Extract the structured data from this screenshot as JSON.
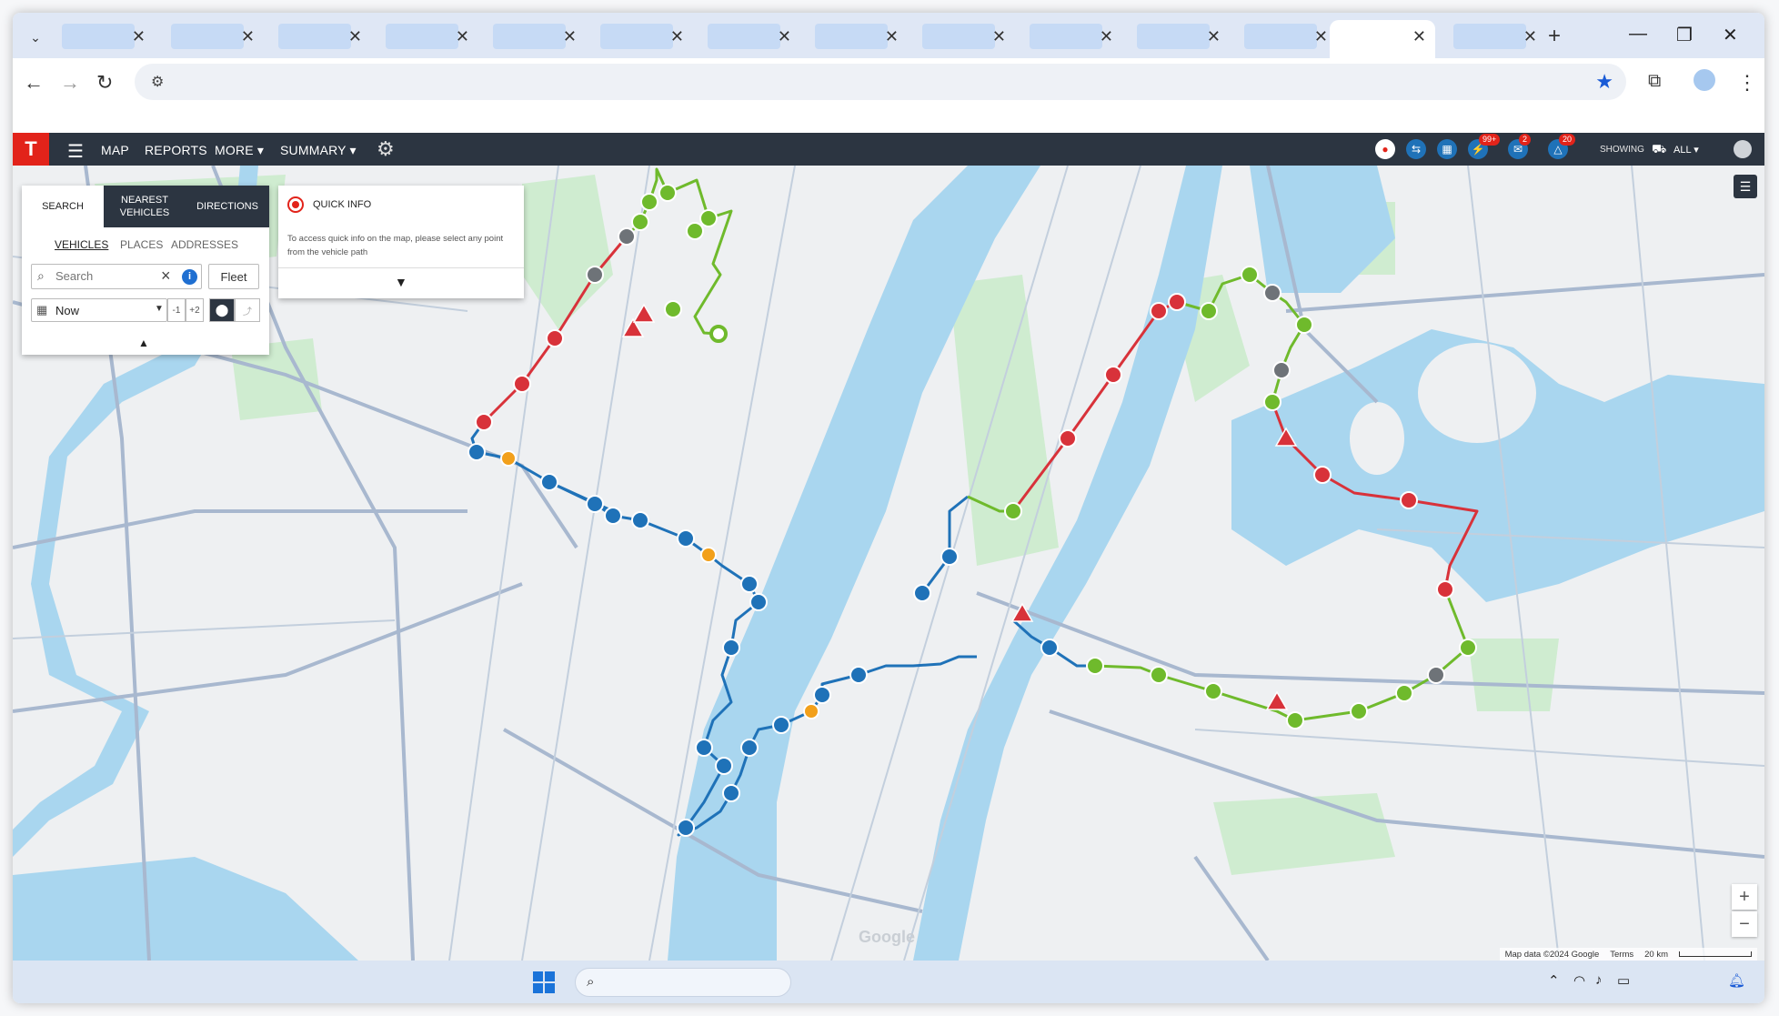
{
  "browser": {
    "tab_close_glyph": "✕",
    "new_tab_glyph": "+",
    "window_controls": {
      "minimize": "—",
      "restore": "❐",
      "close": "✕"
    }
  },
  "app": {
    "logo_text": "T",
    "nav": [
      "MAP",
      "REPORTS",
      "MORE",
      "SUMMARY"
    ],
    "badges": {
      "alerts_a": "99+",
      "messages": "2",
      "warnings": "20"
    },
    "showing_label": "SHOWING",
    "showing_value": "ALL"
  },
  "search_panel": {
    "tabs": {
      "search": "SEARCH",
      "nearest": "NEAREST\nVEHICLES",
      "directions": "DIRECTIONS"
    },
    "subtabs": {
      "vehicles": "VEHICLES",
      "places": "PLACES",
      "addresses": "ADDRESSES"
    },
    "search_placeholder": "Search",
    "fleet_label": "Fleet",
    "time_value": "Now",
    "minus_label": "-1",
    "plus_label": "+2"
  },
  "quick_info": {
    "title": "QUICK INFO",
    "text": "To access quick info on the map, please select any point from the vehicle path"
  },
  "map": {
    "watermark": "Google",
    "attribution": "Map data ©2024 Google",
    "terms": "Terms",
    "scale": "20 km",
    "colors": {
      "red": "#d8323a",
      "green": "#6fba2c",
      "blue": "#1f72b8",
      "orange": "#f2a01b",
      "gray": "#6e7378",
      "water": "#a9d6ef",
      "park": "#cdeccd",
      "road": "#9fb1c9"
    }
  },
  "taskbar": {}
}
